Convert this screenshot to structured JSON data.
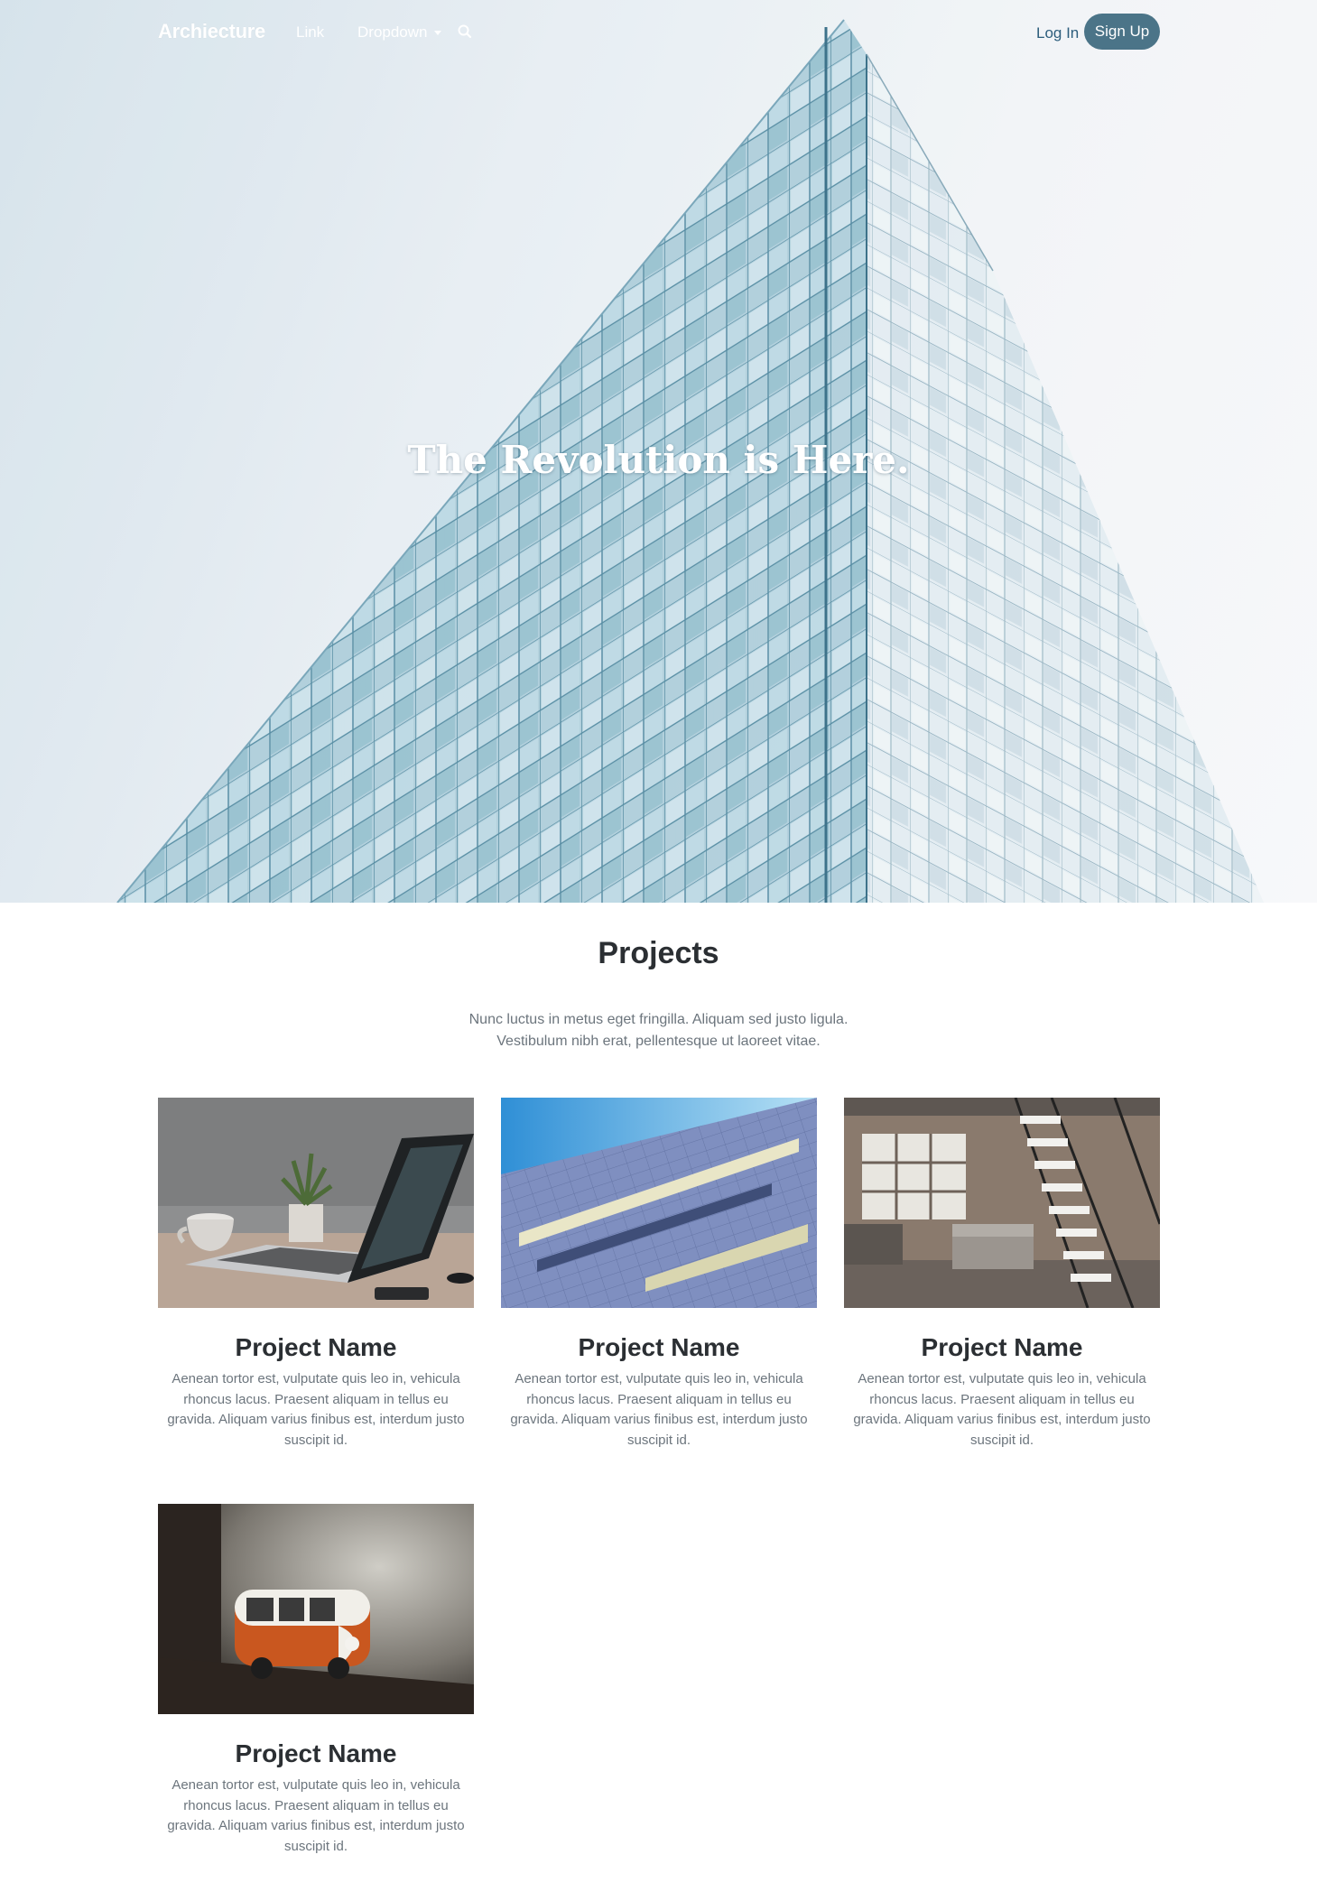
{
  "nav": {
    "brand": "Archiecture",
    "links": [
      "Link",
      "Dropdown"
    ],
    "search_icon": "search-icon",
    "login": "Log In",
    "signup": "Sign Up"
  },
  "hero": {
    "title": "The Revolution is Here."
  },
  "projects": {
    "title": "Projects",
    "intro": "Nunc luctus in metus eget fringilla. Aliquam sed justo ligula. Vestibulum nibh erat, pellentesque ut laoreet vitae.",
    "items": [
      {
        "name": "Project Name",
        "description": "Aenean tortor est, vulputate quis leo in, vehicula rhoncus lacus. Praesent aliquam in tellus eu gravida. Aliquam varius finibus est, interdum justo suscipit id.",
        "image": "laptop-desk-photo"
      },
      {
        "name": "Project Name",
        "description": "Aenean tortor est, vulputate quis leo in, vehicula rhoncus lacus. Praesent aliquam in tellus eu gravida. Aliquam varius finibus est, interdum justo suscipit id.",
        "image": "building-facade-photo"
      },
      {
        "name": "Project Name",
        "description": "Aenean tortor est, vulputate quis leo in, vehicula rhoncus lacus. Praesent aliquam in tellus eu gravida. Aliquam varius finibus est, interdum justo suscipit id.",
        "image": "loft-staircase-photo"
      },
      {
        "name": "Project Name",
        "description": "Aenean tortor est, vulputate quis leo in, vehicula rhoncus lacus. Praesent aliquam in tellus eu gravida. Aliquam varius finibus est, interdum justo suscipit id.",
        "image": "toy-van-photo"
      }
    ]
  },
  "colors": {
    "signup_bg": "#4b7488",
    "login_text": "#2c5d7c",
    "heading": "#2b2f33",
    "muted_text": "#6c757d"
  }
}
